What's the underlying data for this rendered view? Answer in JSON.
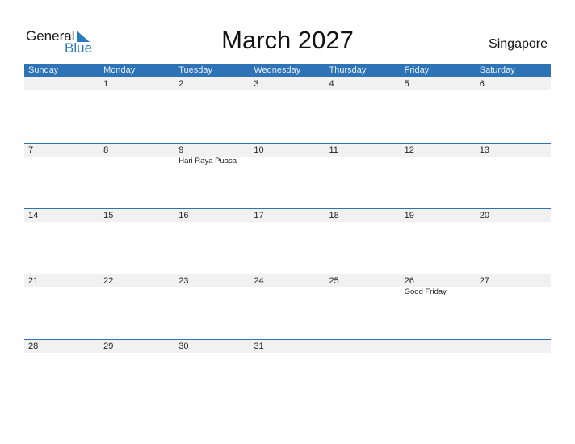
{
  "logo": {
    "general": "General",
    "blue": "Blue"
  },
  "title": "March 2027",
  "country": "Singapore",
  "colors": {
    "header_bg": "#2e73b6",
    "accent": "#2a7ac0",
    "date_row_bg": "#f1f1f1"
  },
  "weekdays": [
    "Sunday",
    "Monday",
    "Tuesday",
    "Wednesday",
    "Thursday",
    "Friday",
    "Saturday"
  ],
  "weeks": [
    {
      "days": [
        "",
        "1",
        "2",
        "3",
        "4",
        "5",
        "6"
      ],
      "events": [
        "",
        "",
        "",
        "",
        "",
        "",
        ""
      ]
    },
    {
      "days": [
        "7",
        "8",
        "9",
        "10",
        "11",
        "12",
        "13"
      ],
      "events": [
        "",
        "",
        "Hari Raya Puasa",
        "",
        "",
        "",
        ""
      ]
    },
    {
      "days": [
        "14",
        "15",
        "16",
        "17",
        "18",
        "19",
        "20"
      ],
      "events": [
        "",
        "",
        "",
        "",
        "",
        "",
        ""
      ]
    },
    {
      "days": [
        "21",
        "22",
        "23",
        "24",
        "25",
        "26",
        "27"
      ],
      "events": [
        "",
        "",
        "",
        "",
        "",
        "Good Friday",
        ""
      ]
    },
    {
      "days": [
        "28",
        "29",
        "30",
        "31",
        "",
        "",
        ""
      ],
      "events": [
        "",
        "",
        "",
        "",
        "",
        "",
        ""
      ]
    }
  ]
}
